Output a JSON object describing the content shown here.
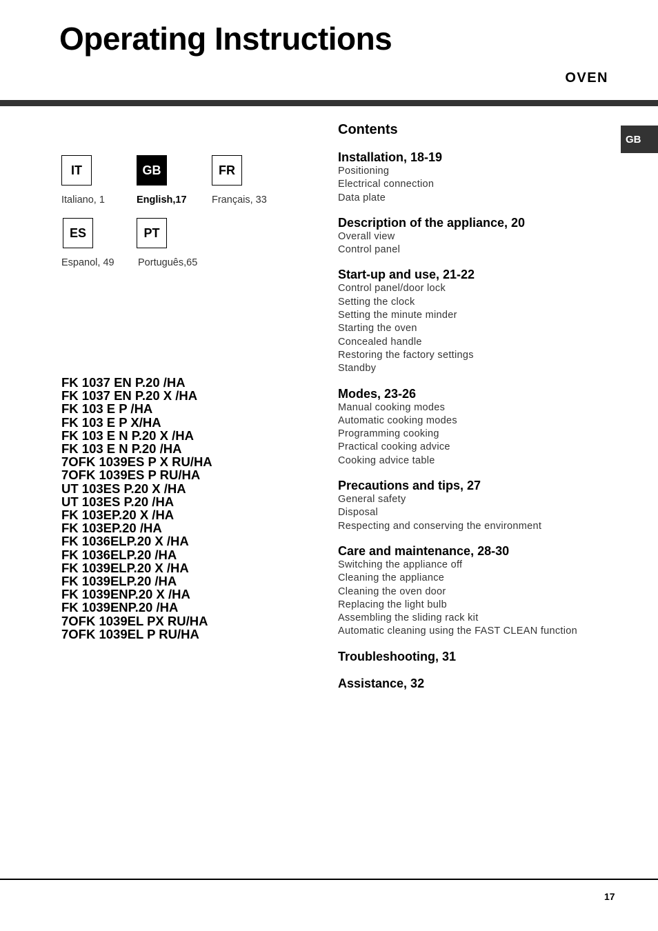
{
  "header": {
    "title": "Operating Instructions",
    "subtitle": "OVEN"
  },
  "side_tab": {
    "label": "GB"
  },
  "languages": [
    {
      "code": "IT",
      "label": "Italiano,  1",
      "active": false
    },
    {
      "code": "GB",
      "label": "English,17",
      "active": true
    },
    {
      "code": "FR",
      "label": "Français, 33",
      "active": false
    },
    {
      "code": "ES",
      "label": "Espanol,  49",
      "active": false
    },
    {
      "code": "PT",
      "label": "Português,65",
      "active": false
    }
  ],
  "models": [
    "FK 1037 EN P.20 /HA",
    "FK 1037 EN P.20 X /HA",
    "FK 103 E P /HA",
    "FK 103 E P X/HA",
    "FK 103 E N P.20 X /HA",
    "FK 103 E N P.20 /HA",
    "7OFK 1039ES P X RU/HA",
    "7OFK 1039ES P RU/HA",
    "UT 103ES P.20 X /HA",
    "UT 103ES P.20 /HA",
    "FK 103EP.20 X /HA",
    "FK 103EP.20 /HA",
    "FK 1036ELP.20 X /HA",
    "FK 1036ELP.20 /HA",
    "FK 1039ELP.20 X /HA",
    "FK 1039ELP.20 /HA",
    "FK 1039ENP.20 X /HA",
    "FK 1039ENP.20 /HA",
    "7OFK 1039EL PX RU/HA",
    "7OFK 1039EL P RU/HA"
  ],
  "contents": {
    "title": "Contents",
    "sections": [
      {
        "heading": "Installation, 18-19",
        "items": [
          "Positioning",
          "Electrical connection",
          "Data plate"
        ]
      },
      {
        "heading": "Description of the appliance, 20",
        "items": [
          "Overall view",
          "Control panel"
        ]
      },
      {
        "heading": "Start-up and use, 21-22",
        "items": [
          "Control panel/door lock",
          "Setting the clock",
          "Setting the minute minder",
          "Starting the oven",
          "Concealed handle",
          "Restoring the factory settings",
          "Standby"
        ]
      },
      {
        "heading": "Modes, 23-26",
        "items": [
          "Manual cooking modes",
          "Automatic cooking modes",
          "Programming cooking",
          "Practical cooking advice",
          "Cooking advice table"
        ]
      },
      {
        "heading": "Precautions and tips, 27",
        "items": [
          "General safety",
          "Disposal",
          "Respecting and conserving the environment"
        ]
      },
      {
        "heading": "Care and maintenance, 28-30",
        "items": [
          "Switching the appliance off",
          "Cleaning the appliance",
          "Cleaning the oven door",
          "Replacing the light bulb",
          "Assembling the sliding rack kit",
          "Automatic cleaning using the FAST CLEAN function"
        ]
      },
      {
        "heading": "Troubleshooting, 31",
        "items": []
      },
      {
        "heading": "Assistance, 32",
        "items": []
      }
    ]
  },
  "footer": {
    "page_number": "17"
  }
}
